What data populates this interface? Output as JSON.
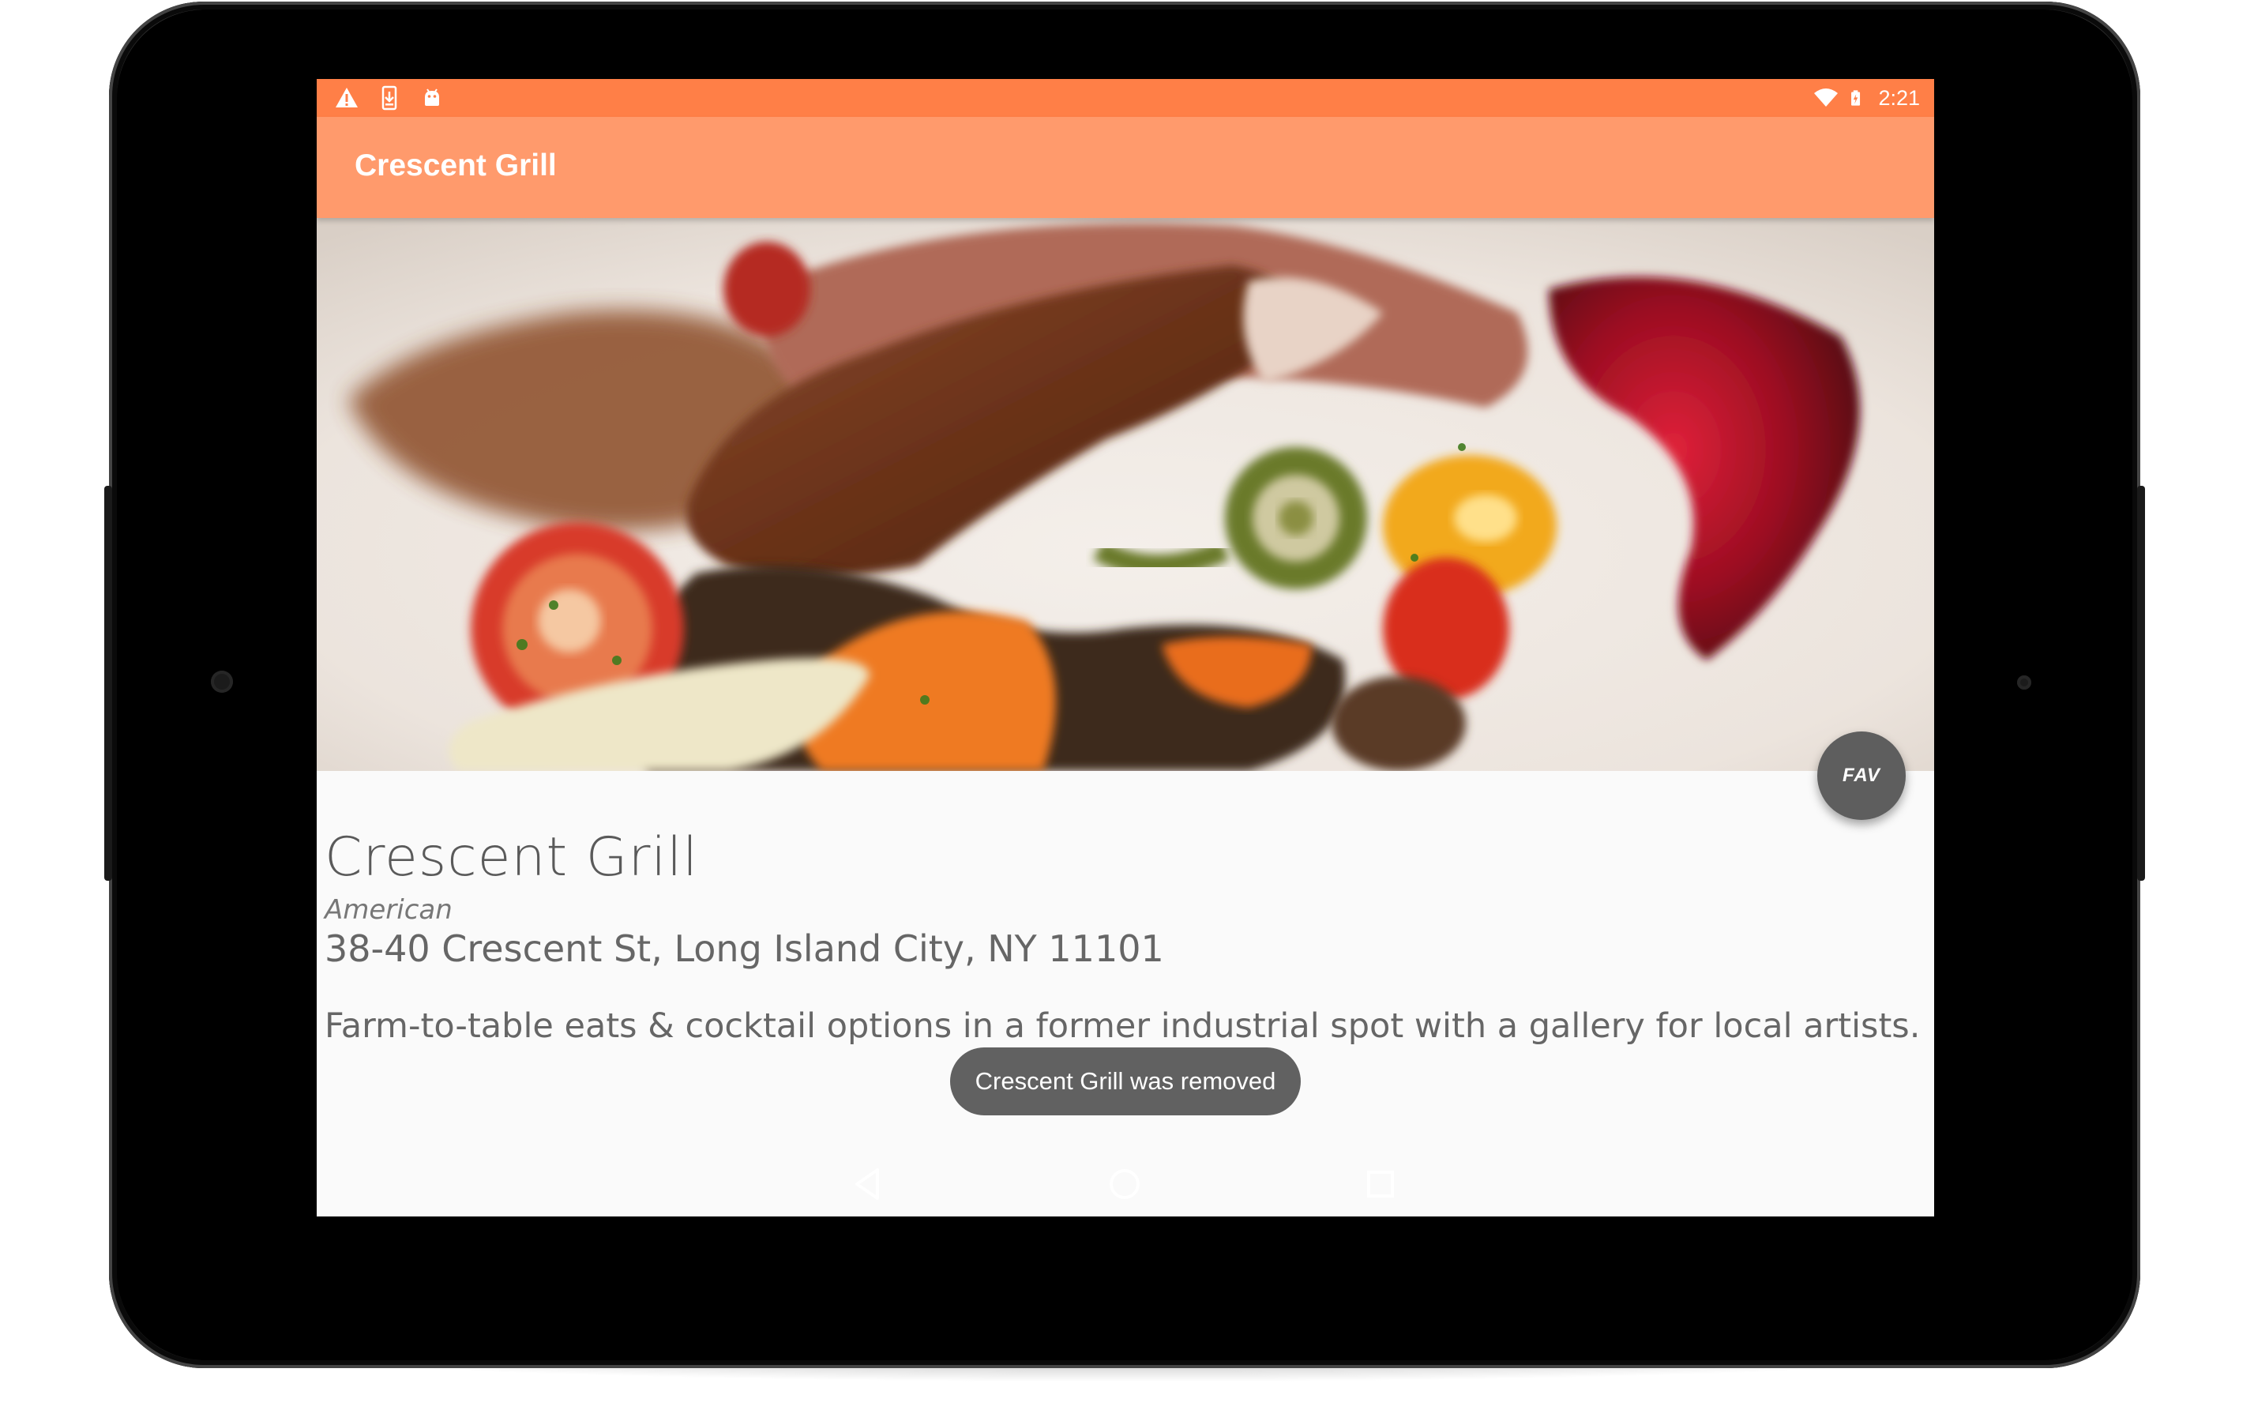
{
  "status_bar": {
    "time": "2:21",
    "left_icons": [
      "warning-icon",
      "download-icon",
      "android-icon"
    ],
    "right_icons": [
      "wifi-icon",
      "battery-charging-icon"
    ]
  },
  "app_bar": {
    "title": "Crescent Grill"
  },
  "restaurant": {
    "name": "Crescent Grill",
    "cuisine": "American",
    "address": "38-40 Crescent St, Long Island City, NY 11101",
    "description": "Farm-to-table eats & cocktail options in a former industrial spot with a gallery for local artists."
  },
  "fab": {
    "label": "FAV"
  },
  "toast": {
    "message": "Crescent Grill was removed"
  },
  "nav_bar": {
    "icons": [
      "back-icon",
      "home-icon",
      "recents-icon"
    ]
  },
  "colors": {
    "status_bar": "#ff7f47",
    "app_bar": "#ff9a6c",
    "fab": "#5e5e5e",
    "toast": "#616161",
    "content_bg": "#fafafa"
  }
}
